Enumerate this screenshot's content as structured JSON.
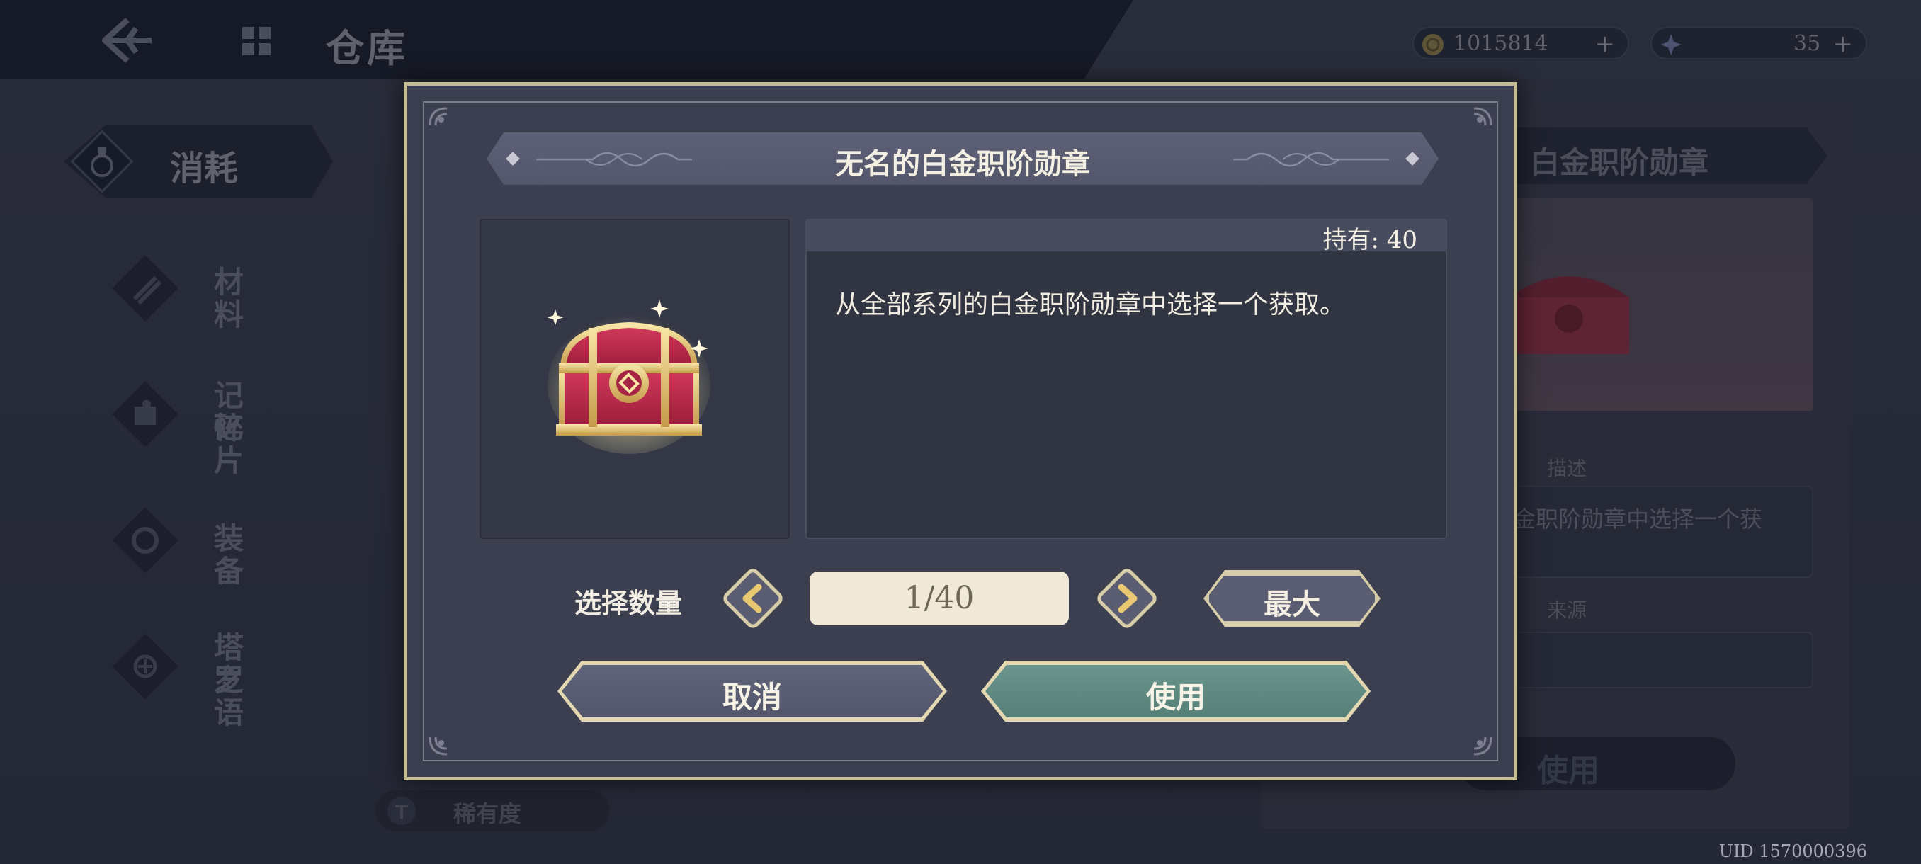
{
  "header": {
    "title": "仓库",
    "gold": "1015814",
    "gems": "35",
    "plus": "+"
  },
  "sidebar": {
    "active": "消耗",
    "items": [
      {
        "label": "材料"
      },
      {
        "label": "记忆\n碎片",
        "l1": "记忆",
        "l2": "碎片"
      },
      {
        "label": "装备"
      },
      {
        "label": "塔罗\n之语",
        "l1": "塔罗",
        "l2": "之语"
      }
    ]
  },
  "right_panel": {
    "title": "白金职阶勋章",
    "desc_label": "描述",
    "desc_text": "金职阶勋章中选择一个获",
    "source_label": "来源",
    "use_label": "使用"
  },
  "rarity_label": "稀有度",
  "uid": "UID 1570000396",
  "dialog": {
    "title": "无名的白金职阶勋章",
    "holding": "持有: 40",
    "description": "从全部系列的白金职阶勋章中选择一个获取。",
    "quantity_label": "选择数量",
    "quantity_value": "1/40",
    "max_label": "最大",
    "cancel_label": "取消",
    "use_label": "使用"
  },
  "colors": {
    "accent_gold": "#c4bb97",
    "use_button": "#5e8a82",
    "cancel_button": "#5a5d72"
  }
}
